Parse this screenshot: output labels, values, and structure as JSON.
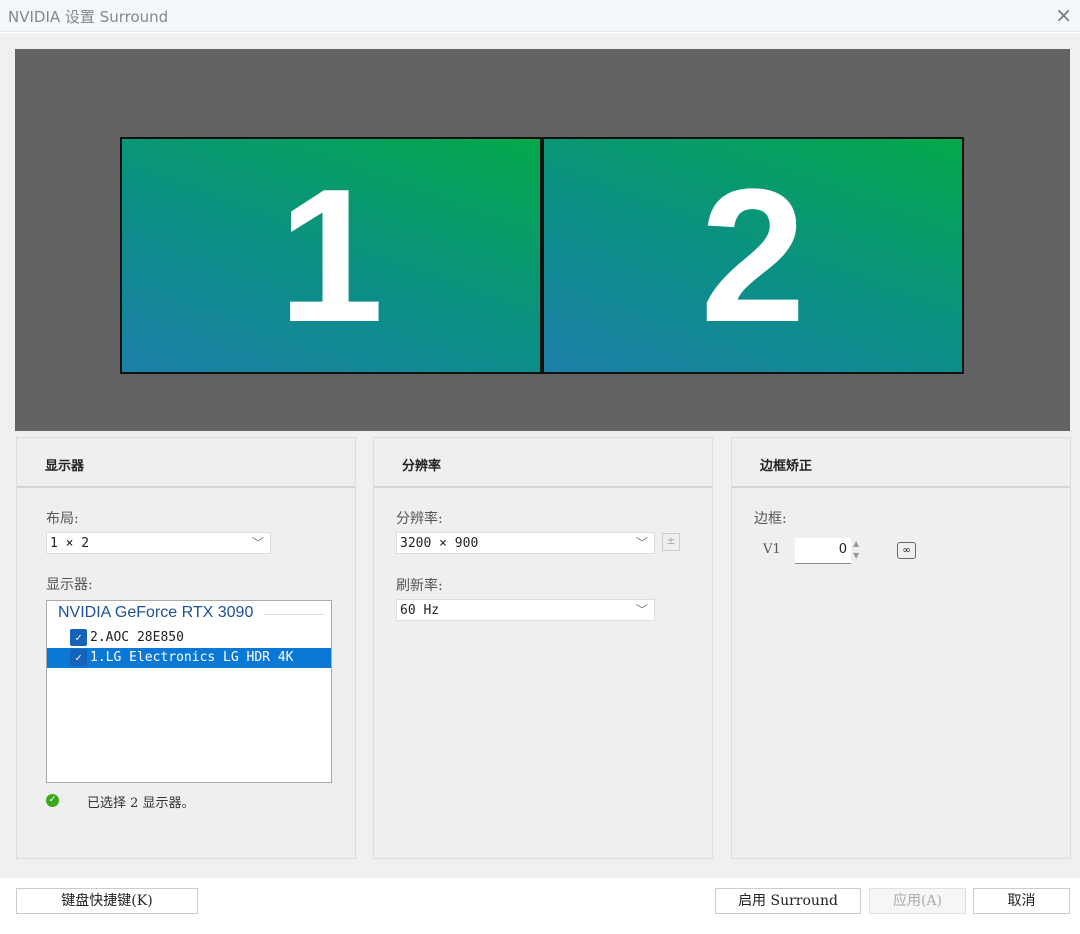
{
  "window": {
    "title": "NVIDIA 设置 Surround",
    "close_icon": "×"
  },
  "preview": {
    "monitors": [
      "1",
      "2"
    ]
  },
  "panels": {
    "display": {
      "header": "显示器",
      "layout_label": "布局:",
      "layout_value": "1 × 2",
      "displays_label": "显示器:",
      "gpu": "NVIDIA GeForce RTX 3090",
      "items": [
        {
          "label": "2.AOC 28E850",
          "checked": true,
          "selected": false
        },
        {
          "label": "1.LG Electronics LG HDR 4K",
          "checked": true,
          "selected": true
        }
      ],
      "status": "已选择 2 显示器。"
    },
    "resolution": {
      "header": "分辨率",
      "resolution_label": "分辨率:",
      "resolution_value": "3200 × 900",
      "refresh_label": "刷新率:",
      "refresh_value": "60 Hz"
    },
    "bezel": {
      "header": "边框矫正",
      "bezel_label": "边框:",
      "v1_label": "V1",
      "v1_value": "0"
    }
  },
  "footer": {
    "shortcut": "键盘快捷键(K)",
    "enable": "启用 Surround",
    "apply": "应用(A)",
    "cancel": "取消"
  },
  "colors": {
    "accent": "#1463b8",
    "selection": "#0b78d6",
    "status_ok": "#3aa81e"
  }
}
